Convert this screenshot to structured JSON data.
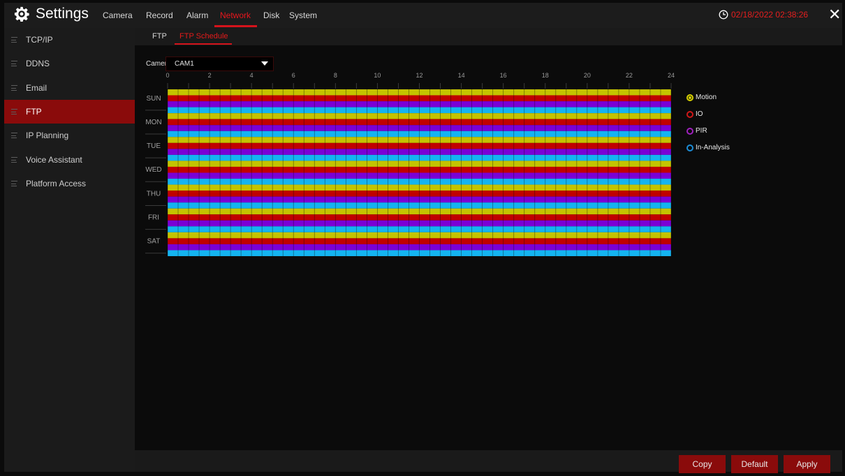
{
  "app": {
    "title": "Settings",
    "icon": "gear-icon"
  },
  "nav": {
    "tabs": [
      {
        "label": "Camera",
        "active": false
      },
      {
        "label": "Record",
        "active": false
      },
      {
        "label": "Alarm",
        "active": false
      },
      {
        "label": "Network",
        "active": true
      },
      {
        "label": "Disk",
        "active": false
      },
      {
        "label": "System",
        "active": false
      }
    ]
  },
  "clock": {
    "icon": "clock-icon",
    "datetime": "02/18/2022 02:38:26"
  },
  "close": {
    "label": "✕",
    "icon": "close-icon"
  },
  "sidebar": {
    "items": [
      {
        "label": "TCP/IP",
        "active": false
      },
      {
        "label": "DDNS",
        "active": false
      },
      {
        "label": "Email",
        "active": false
      },
      {
        "label": "FTP",
        "active": true
      },
      {
        "label": "IP Planning",
        "active": false
      },
      {
        "label": "Voice Assistant",
        "active": false
      },
      {
        "label": "Platform Access",
        "active": false
      }
    ]
  },
  "subtabs": [
    {
      "label": "FTP",
      "active": false
    },
    {
      "label": "FTP Schedule",
      "active": true
    }
  ],
  "camera": {
    "label": "Camera",
    "value": "CAM1"
  },
  "schedule": {
    "hour_labels": [
      "0",
      "2",
      "4",
      "6",
      "8",
      "10",
      "12",
      "14",
      "16",
      "18",
      "20",
      "22",
      "24"
    ],
    "days": [
      "SUN",
      "MON",
      "TUE",
      "WED",
      "THU",
      "FRI",
      "SAT"
    ],
    "row_types": [
      "motion",
      "io",
      "pir",
      "in-analysis"
    ],
    "row_colors": [
      "#c4c300",
      "#c00000",
      "#7a00d6",
      "#14b4f0"
    ],
    "full_coverage": true
  },
  "legend": [
    {
      "label": "Motion",
      "color": "#d6d000"
    },
    {
      "label": "IO",
      "color": "#d01818"
    },
    {
      "label": "PIR",
      "color": "#a020c0"
    },
    {
      "label": "In-Analysis",
      "color": "#1c8ed8"
    }
  ],
  "buttons": {
    "copy": "Copy",
    "default": "Default",
    "apply": "Apply"
  },
  "colors": {
    "accent": "#8a0b0b",
    "active_text": "#e8161c"
  }
}
